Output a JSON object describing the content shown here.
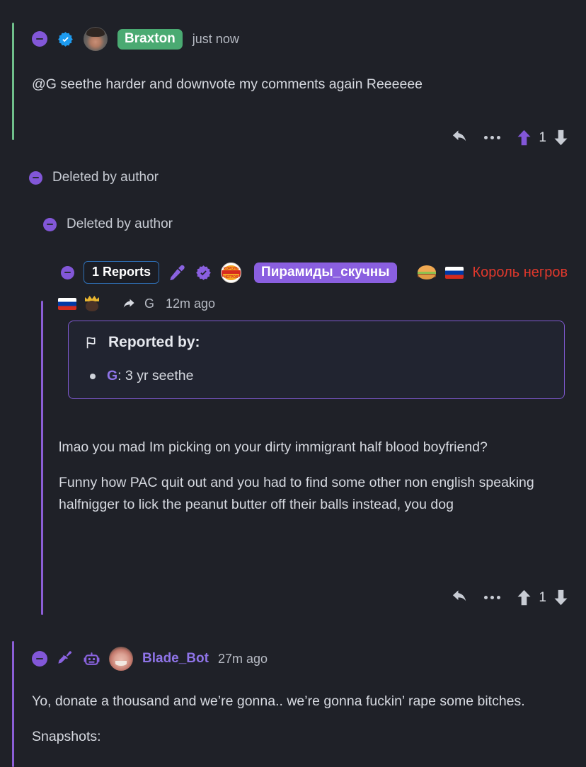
{
  "theme": {
    "background": "#1f2128",
    "text": "#d7dae1",
    "accent_purple": "#8257d8",
    "username_purple": "#8f74e8",
    "thread_green": "#6fbf8b",
    "thread_purple": "#8b5ed6",
    "pill_green": "#4aaa72",
    "pill_purple": "#8a5fe0",
    "verified_blue": "#1d9bf0",
    "report_border_blue": "#2f6fb5",
    "red_flair": "#e0382c",
    "upvote_active": "#8257d8"
  },
  "comments": [
    {
      "id": "braxton",
      "thread_color": "thread_green",
      "collapse_label": "collapse",
      "username": "Braxton",
      "username_style": "pill-green",
      "timestamp": "just now",
      "badges": [
        "verified-blue-icon"
      ],
      "avatar": "braxton-avatar",
      "paragraphs": [
        "@G seethe harder and downvote my comments again Reeeeee"
      ],
      "actions": {
        "reply_label": "reply",
        "more_label": "more options",
        "upvote_label": "upvote",
        "downvote_label": "downvote",
        "score": "1",
        "upvoted": true
      }
    },
    {
      "id": "deleted-1",
      "label": "Deleted by author"
    },
    {
      "id": "deleted-2",
      "label": "Deleted by author"
    },
    {
      "id": "piramidy",
      "thread_color": "thread_purple",
      "reports_badge": "1 Reports",
      "username": "Пирамиды_скучны",
      "username_style": "pill-purple",
      "flair_text": "Король негров",
      "timestamp": "12m ago",
      "reply_to": "G",
      "badges": [
        "microphone-icon",
        "verified-purple-icon",
        "burger-king-icon"
      ],
      "emoji_row": [
        "russian-flag",
        "crowned-person"
      ],
      "reported_by": {
        "title": "Reported by:",
        "entries": [
          {
            "user": "G",
            "reason": ": 3 yr seethe"
          }
        ]
      },
      "paragraphs": [
        "lmao you mad Im picking on your dirty immigrant half blood boyfriend?",
        "Funny how PAC quit out and you had to find some other non english speaking halfnigger to lick the peanut butter off their balls instead, you dog"
      ],
      "actions": {
        "reply_label": "reply",
        "more_label": "more options",
        "upvote_label": "upvote",
        "downvote_label": "downvote",
        "score": "1",
        "upvoted": false
      }
    },
    {
      "id": "blade-bot",
      "thread_color": "thread_purple",
      "username": "Blade_Bot",
      "username_style": "plain-purple",
      "timestamp": "27m ago",
      "badges": [
        "broom-icon",
        "robot-icon"
      ],
      "avatar": "blade-avatar",
      "paragraphs": [
        "Yo, donate a thousand and we’re gonna.. we’re gonna fuckin’ rape some bitches.",
        "Snapshots:"
      ]
    }
  ]
}
